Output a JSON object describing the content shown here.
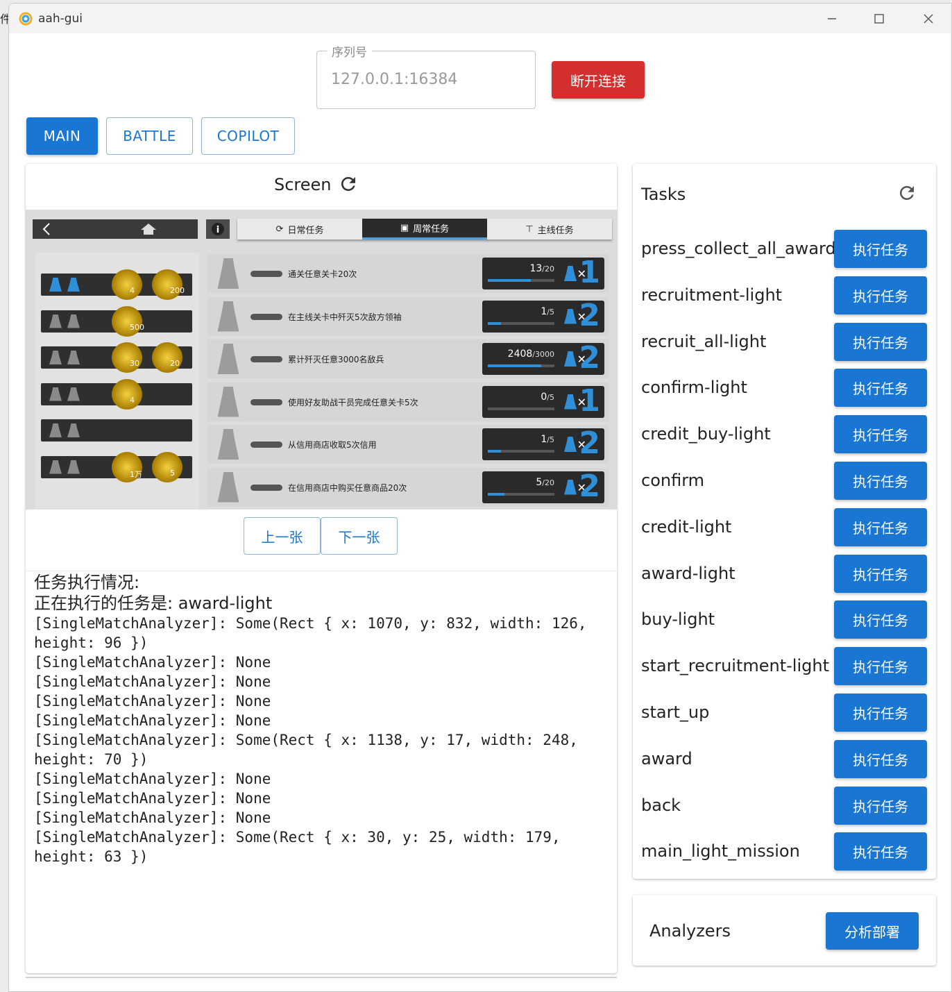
{
  "window": {
    "title": "aah-gui",
    "edge_text": "件"
  },
  "serial": {
    "label": "序列号",
    "value": "127.0.0.1:16384",
    "disconnect_label": "断开连接"
  },
  "tabs": [
    {
      "label": "MAIN",
      "active": true
    },
    {
      "label": "BATTLE",
      "active": false
    },
    {
      "label": "COPILOT",
      "active": false
    }
  ],
  "screen": {
    "title": "Screen",
    "prev_label": "上一张",
    "next_label": "下一张",
    "game": {
      "tabs": [
        "日常任务",
        "周常任务",
        "主线任务"
      ],
      "active_tab": "周常任务",
      "rewards": [
        {
          "items": [
            "4",
            "200"
          ]
        },
        {
          "items": [
            "500"
          ]
        },
        {
          "items": [
            "30",
            "20"
          ]
        },
        {
          "items": [
            "4"
          ]
        },
        {
          "items": []
        },
        {
          "items": [
            "1万",
            "5"
          ]
        }
      ],
      "missions": [
        {
          "text": "通关任意关卡20次",
          "progress": "13",
          "total": "/20",
          "num": "1",
          "fill": 0.65
        },
        {
          "text": "在主线关卡中歼灭5次敌方领袖",
          "progress": "1",
          "total": "/5",
          "num": "2",
          "fill": 0.2
        },
        {
          "text": "累计歼灭任意3000名敌兵",
          "progress": "2408",
          "total": "/3000",
          "num": "2",
          "fill": 0.8
        },
        {
          "text": "使用好友助战干员完成任意关卡5次",
          "progress": "0",
          "total": "/5",
          "num": "1",
          "fill": 0.0
        },
        {
          "text": "从信用商店收取5次信用",
          "progress": "1",
          "total": "/5",
          "num": "2",
          "fill": 0.2
        },
        {
          "text": "在信用商店中购买任意商品20次",
          "progress": "5",
          "total": "/20",
          "num": "2",
          "fill": 0.25
        }
      ]
    }
  },
  "log": {
    "heading": "任务执行情况:",
    "current": "正在执行的任务是: award-light",
    "lines": [
      "[SingleMatchAnalyzer]: Some(Rect { x: 1070, y: 832, width: 126, height: 96 })",
      "[SingleMatchAnalyzer]: None",
      "[SingleMatchAnalyzer]: None",
      "[SingleMatchAnalyzer]: None",
      "[SingleMatchAnalyzer]: None",
      "[SingleMatchAnalyzer]: Some(Rect { x: 1138, y: 17, width: 248, height: 70 })",
      "[SingleMatchAnalyzer]: None",
      "[SingleMatchAnalyzer]: None",
      "[SingleMatchAnalyzer]: None",
      "[SingleMatchAnalyzer]: Some(Rect { x: 30, y: 25, width: 179, height: 63 })"
    ]
  },
  "tasks": {
    "title": "Tasks",
    "button_label": "执行任务",
    "items": [
      "press_collect_all_award",
      "recruitment-light",
      "recruit_all-light",
      "confirm-light",
      "credit_buy-light",
      "confirm",
      "credit-light",
      "award-light",
      "buy-light",
      "start_recruitment-light",
      "start_up",
      "award",
      "back",
      "main_light_mission"
    ]
  },
  "analyzers": {
    "title": "Analyzers",
    "button_label": "分析部署"
  },
  "colors": {
    "primary": "#1976d2",
    "danger": "#d32f2f",
    "accent_blue": "#2f8fd8"
  }
}
